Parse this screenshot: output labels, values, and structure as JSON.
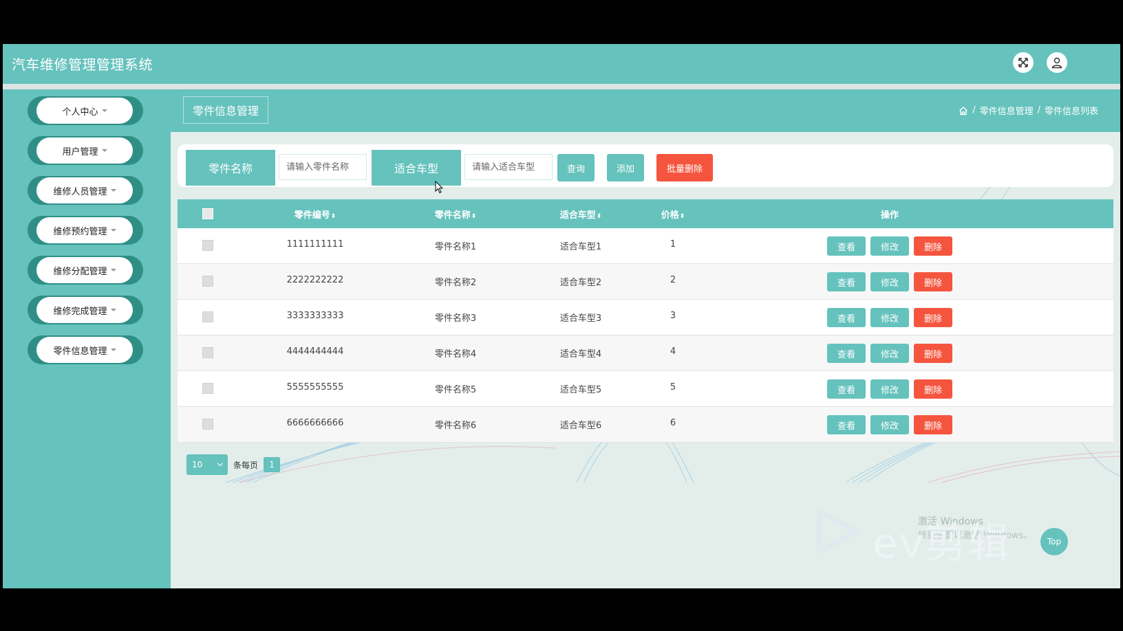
{
  "app": {
    "title": "汽车维修管理管理系统"
  },
  "header": {
    "fullscreen_icon": "expand-icon",
    "user_icon": "user-icon"
  },
  "sidebar": {
    "items": [
      {
        "label": "个人中心"
      },
      {
        "label": "用户管理"
      },
      {
        "label": "维修人员管理"
      },
      {
        "label": "维修预约管理"
      },
      {
        "label": "维修分配管理"
      },
      {
        "label": "维修完成管理"
      },
      {
        "label": "零件信息管理"
      }
    ]
  },
  "page": {
    "tag": "零件信息管理",
    "breadcrumb": {
      "sep": "/",
      "level1": "零件信息管理",
      "level2": "零件信息列表"
    }
  },
  "search": {
    "name_label": "零件名称",
    "name_placeholder": "请输入零件名称",
    "model_label": "适合车型",
    "model_placeholder": "请输入适合车型",
    "query_button": "查询",
    "add_button": "添加",
    "batch_delete_button": "批量删除"
  },
  "table": {
    "columns": {
      "code": "零件编号",
      "name": "零件名称",
      "model": "适合车型",
      "price": "价格",
      "ops": "操作"
    },
    "sort_glyph": "⬍",
    "rows": [
      {
        "code": "1111111111",
        "name": "零件名称1",
        "model": "适合车型1",
        "price": "1"
      },
      {
        "code": "2222222222",
        "name": "零件名称2",
        "model": "适合车型2",
        "price": "2"
      },
      {
        "code": "3333333333",
        "name": "零件名称3",
        "model": "适合车型3",
        "price": "3"
      },
      {
        "code": "4444444444",
        "name": "零件名称4",
        "model": "适合车型4",
        "price": "4"
      },
      {
        "code": "5555555555",
        "name": "零件名称5",
        "model": "适合车型5",
        "price": "5"
      },
      {
        "code": "6666666666",
        "name": "零件名称6",
        "model": "适合车型6",
        "price": "6"
      }
    ],
    "actions": {
      "view": "查看",
      "edit": "修改",
      "delete": "删除"
    }
  },
  "pager": {
    "page_size": "10",
    "per_page_label": "条每页",
    "current_page": "1"
  },
  "overlay": {
    "activate_windows_1": "激活 Windows",
    "activate_windows_2": "转到设置以激活 Windows。",
    "watermark": "ev剪辑"
  },
  "back_to_top": "Top",
  "colors": {
    "primary": "#65c2bd",
    "danger": "#f5553e",
    "sidebar_pill_edge": "#2f8f87"
  }
}
